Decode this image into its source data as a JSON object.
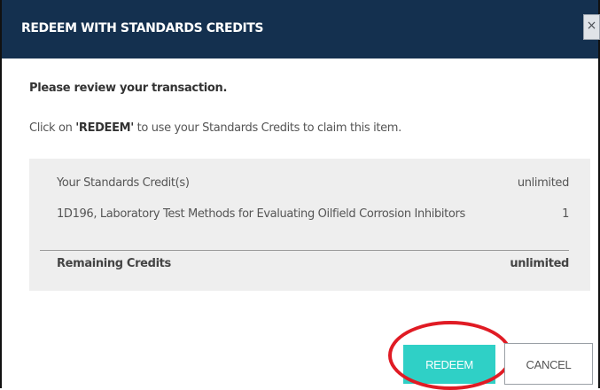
{
  "dialog": {
    "title": "REDEEM WITH STANDARDS CREDITS",
    "close_label": "×",
    "lead": "Please review your transaction.",
    "instruction_before": "Click on ",
    "instruction_emph": "'REDEEM'",
    "instruction_after": " to use your Standards Credits to claim this item."
  },
  "summary": {
    "rows": [
      {
        "label": "Your Standards Credit(s)",
        "value": "unlimited"
      },
      {
        "label": "1D196, Laboratory Test Methods for Evaluating Oilfield Corrosion Inhibitors",
        "value": "1"
      }
    ],
    "total": {
      "label": "Remaining Credits",
      "value": "unlimited"
    }
  },
  "actions": {
    "redeem_label": "REDEEM",
    "cancel_label": "CANCEL"
  },
  "colors": {
    "header": "#14304f",
    "redeem": "#2fd0c6",
    "highlight": "#e01b24"
  }
}
